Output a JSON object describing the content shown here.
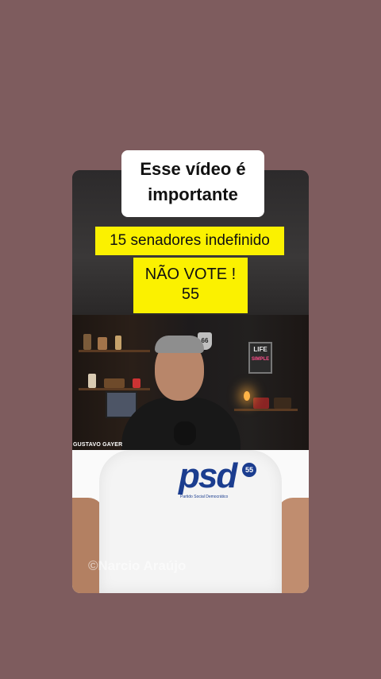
{
  "overlay": {
    "title_line1": "Esse vídeo é",
    "title_line2": "importante",
    "banner_senators": "15 senadores indefinido",
    "banner_vote_line1": "NÃO VOTE !",
    "banner_vote_line2": "55"
  },
  "video": {
    "presenter_name": "GUSTAVO GAYER",
    "sign_number": "66",
    "life_sign_line1": "LIFE",
    "life_sign_line2": "SIMPLE"
  },
  "shirt": {
    "party_logo_text": "psd",
    "party_number": "55",
    "party_full_name": "Partido Social Democrático",
    "watermark": "©Narcio Araújo"
  },
  "colors": {
    "background": "#7e5c5e",
    "banner_yellow": "#fbf100",
    "psd_blue": "#1b3d8f"
  }
}
